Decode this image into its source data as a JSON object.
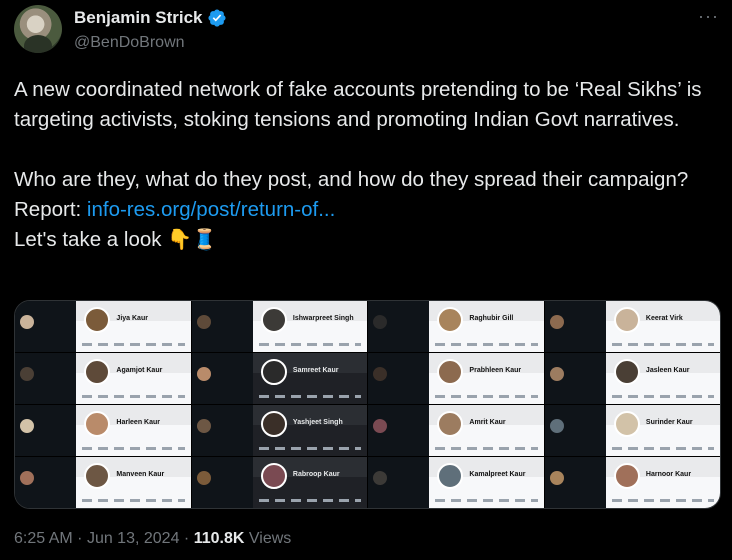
{
  "author": {
    "display_name": "Benjamin Strick",
    "handle": "@BenDoBrown",
    "verified": true,
    "accent_color": "#1d9bf0"
  },
  "tweet": {
    "line1": "A new coordinated network of fake accounts pretending to be ‘Real Sikhs’ is targeting activists, stoking tensions and promoting Indian Govt narratives.",
    "line2": "Who are they, what do they post, and how do they spread their campaign? Report: ",
    "link_text": "info-res.org/post/return-of...",
    "line3": "Let's take a look ",
    "emojis": "👇🧵"
  },
  "media": {
    "profiles": [
      "Jiya Kaur",
      "Ishwarpreet Singh",
      "Raghubir Gill",
      "Keerat Virk",
      "Agamjot Kaur",
      "Samreet Kaur",
      "Prabhleen Kaur",
      "Jasleen Kaur",
      "Harleen Kaur",
      "Yashjeet Singh",
      "Amrit Kaur",
      "Surinder Kaur",
      "Manveen Kaur",
      "Rabroop Kaur",
      "Kamalpreet Kaur",
      "Harnoor Kaur"
    ]
  },
  "meta": {
    "time": "6:25 AM",
    "date": "Jun 13, 2024",
    "views_count": "110.8K",
    "views_label": "Views",
    "separator": "·"
  },
  "icons": {
    "verified": "verified-badge-icon",
    "more": "more-horizontal-icon"
  }
}
